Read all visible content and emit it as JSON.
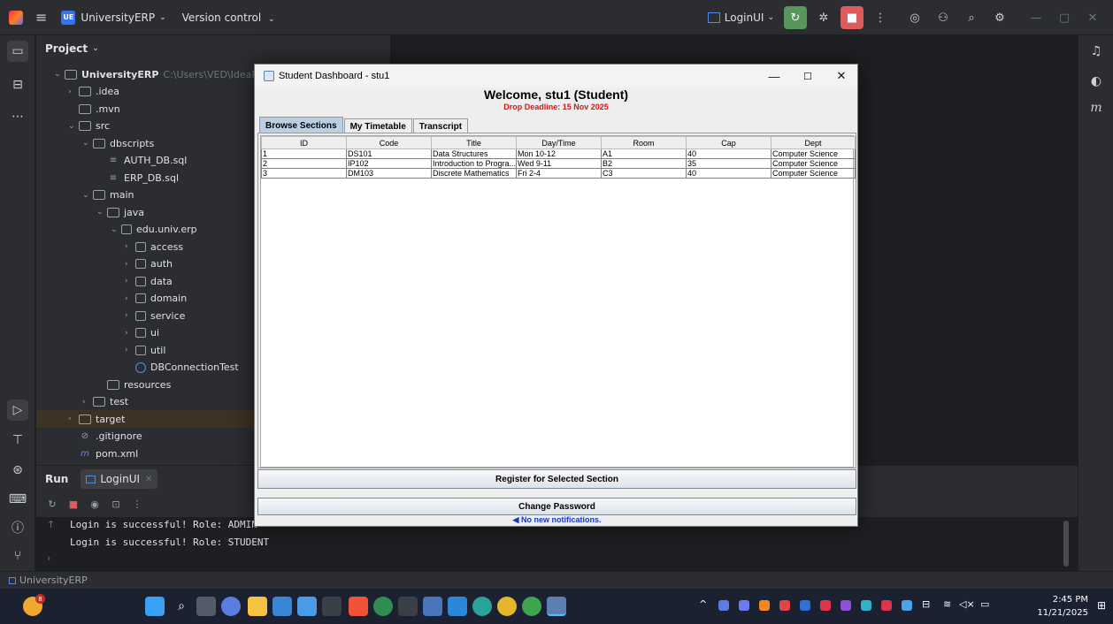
{
  "ide": {
    "project_badge": "UE",
    "project_name": "UniversityERP",
    "version_control": "Version control",
    "run_config": "LoginUI",
    "panel_title": "Project",
    "status_project": "UniversityERP"
  },
  "tree": [
    {
      "label": "UniversityERP",
      "extra": "C:\\Users\\VED\\IdeaProjec",
      "indent": 0,
      "kind": "folder",
      "arrow": "v"
    },
    {
      "label": ".idea",
      "indent": 1,
      "kind": "folder",
      "arrow": ">"
    },
    {
      "label": ".mvn",
      "indent": 1,
      "kind": "folder",
      "arrow": ""
    },
    {
      "label": "src",
      "indent": 1,
      "kind": "folder",
      "arrow": "v"
    },
    {
      "label": "dbscripts",
      "indent": 2,
      "kind": "folder",
      "arrow": "v"
    },
    {
      "label": "AUTH_DB.sql",
      "indent": 3,
      "kind": "file",
      "arrow": ""
    },
    {
      "label": "ERP_DB.sql",
      "indent": 3,
      "kind": "file",
      "arrow": ""
    },
    {
      "label": "main",
      "indent": 2,
      "kind": "folder",
      "arrow": "v"
    },
    {
      "label": "java",
      "indent": 3,
      "kind": "folder",
      "arrow": "v"
    },
    {
      "label": "edu.univ.erp",
      "indent": 4,
      "kind": "pkg",
      "arrow": "v"
    },
    {
      "label": "access",
      "indent": 5,
      "kind": "pkg",
      "arrow": ">"
    },
    {
      "label": "auth",
      "indent": 5,
      "kind": "pkg",
      "arrow": ">"
    },
    {
      "label": "data",
      "indent": 5,
      "kind": "pkg",
      "arrow": ">"
    },
    {
      "label": "domain",
      "indent": 5,
      "kind": "pkg",
      "arrow": ">"
    },
    {
      "label": "service",
      "indent": 5,
      "kind": "pkg",
      "arrow": ">"
    },
    {
      "label": "ui",
      "indent": 5,
      "kind": "pkg",
      "arrow": ">"
    },
    {
      "label": "util",
      "indent": 5,
      "kind": "pkg",
      "arrow": ">"
    },
    {
      "label": "DBConnectionTest",
      "indent": 5,
      "kind": "class",
      "arrow": ""
    },
    {
      "label": "resources",
      "indent": 3,
      "kind": "folder",
      "arrow": ""
    },
    {
      "label": "test",
      "indent": 2,
      "kind": "folder",
      "arrow": ">"
    },
    {
      "label": "target",
      "indent": 1,
      "kind": "folder",
      "arrow": ">"
    },
    {
      "label": ".gitignore",
      "indent": 1,
      "kind": "ignore",
      "arrow": ""
    },
    {
      "label": "pom.xml",
      "indent": 1,
      "kind": "maven",
      "arrow": ""
    }
  ],
  "run": {
    "label": "Run",
    "tab": "LoginUI",
    "lines": [
      "Login is successful! Role: ADMIN",
      "Login is successful! Role: STUDENT"
    ]
  },
  "dialog": {
    "title": "Student Dashboard - stu1",
    "welcome": "Welcome, stu1 (Student)",
    "deadline": "Drop Deadline: 15 Nov 2025",
    "tabs": [
      "Browse Sections",
      "My Timetable",
      "Transcript"
    ],
    "columns": [
      "ID",
      "Code",
      "Title",
      "Day/Time",
      "Room",
      "Cap",
      "Dept"
    ],
    "rows": [
      [
        "1",
        "DS101",
        "Data Structures",
        "Mon 10-12",
        "A1",
        "40",
        "Computer Science"
      ],
      [
        "2",
        "IP102",
        "Introduction to Progra...",
        "Wed 9-11",
        "B2",
        "35",
        "Computer Science"
      ],
      [
        "3",
        "DM103",
        "Discrete Mathematics",
        "Fri 2-4",
        "C3",
        "40",
        "Computer Science"
      ]
    ],
    "register_button": "Register for Selected Section",
    "change_password_button": "Change Password",
    "notification": "No new notifications."
  },
  "taskbar": {
    "time": "2:45 PM",
    "date": "11/21/2025",
    "notification_count": "8"
  }
}
